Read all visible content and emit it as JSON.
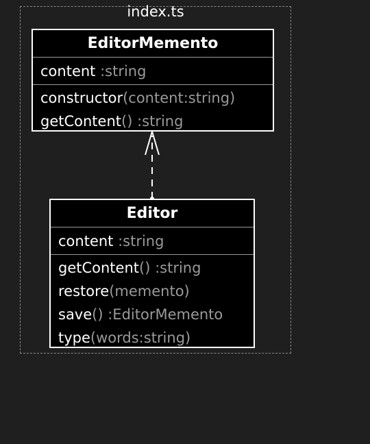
{
  "package": {
    "label": "index.ts"
  },
  "classes": {
    "memento": {
      "name": "EditorMemento",
      "attributes": [
        {
          "name": "content",
          "type": ":string"
        }
      ],
      "operations": [
        {
          "name": "constructor",
          "signature": "(content:string)"
        },
        {
          "name": "getContent",
          "signature": "() :string"
        }
      ]
    },
    "editor": {
      "name": "Editor",
      "attributes": [
        {
          "name": "content",
          "type": ":string"
        }
      ],
      "operations": [
        {
          "name": "getContent",
          "signature": "() :string"
        },
        {
          "name": "restore",
          "signature": "(memento)"
        },
        {
          "name": "save",
          "signature": "() :EditorMemento"
        },
        {
          "name": "type",
          "signature": "(words:string)"
        }
      ]
    }
  },
  "relations": [
    {
      "from": "Editor",
      "to": "EditorMemento",
      "kind": "dependency"
    }
  ]
}
